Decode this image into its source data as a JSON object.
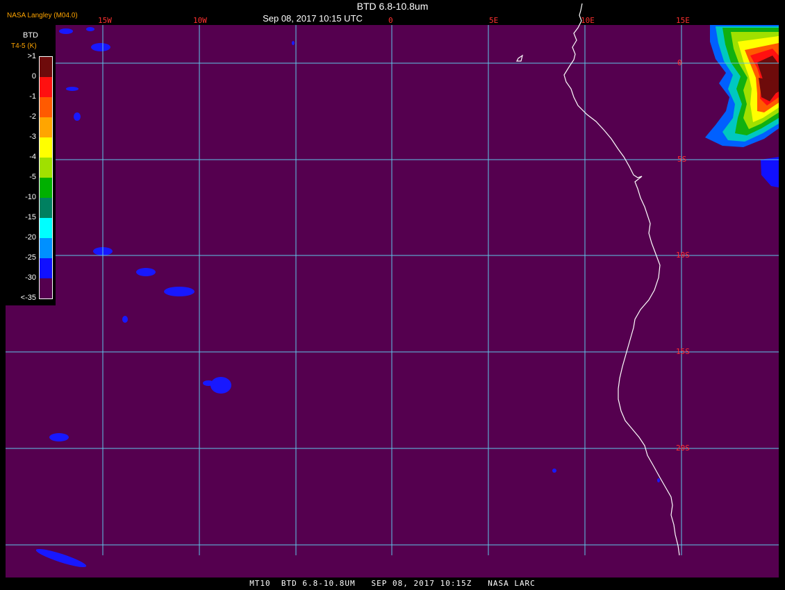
{
  "header": {
    "title": "BTD 6.8-10.8um",
    "time": "Sep 08, 2017 10:15 UTC",
    "producer": "NASA Langley (M04.0)"
  },
  "footer": {
    "text": "MT10  BTD 6.8-10.8UM   SEP 08, 2017 10:15Z   NASA LARC"
  },
  "legend": {
    "title": "BTD",
    "unit": "T4-5 (K)",
    "ticks": [
      ">1",
      "0",
      "-1",
      "-2",
      "-3",
      "-4",
      "-5",
      "-10",
      "-15",
      "-20",
      "-25",
      "-30",
      "<-35"
    ],
    "colors": [
      "#6e0b0b",
      "#ff1010",
      "#ff5a00",
      "#ffa500",
      "#ffff00",
      "#a0e000",
      "#00b000",
      "#008060",
      "#00ffff",
      "#0090ff",
      "#1010ff",
      "#55004f"
    ]
  },
  "map": {
    "longitude_labels": [
      "15W",
      "10W",
      "0",
      "5E",
      "10E",
      "15E"
    ],
    "latitude_labels": [
      "0",
      "5S",
      "10S",
      "15S",
      "20S"
    ],
    "colors": {
      "background": "#55004f",
      "grid": "#5fc8e8",
      "coastline": "#ffffff",
      "label": "#ff3030"
    }
  }
}
